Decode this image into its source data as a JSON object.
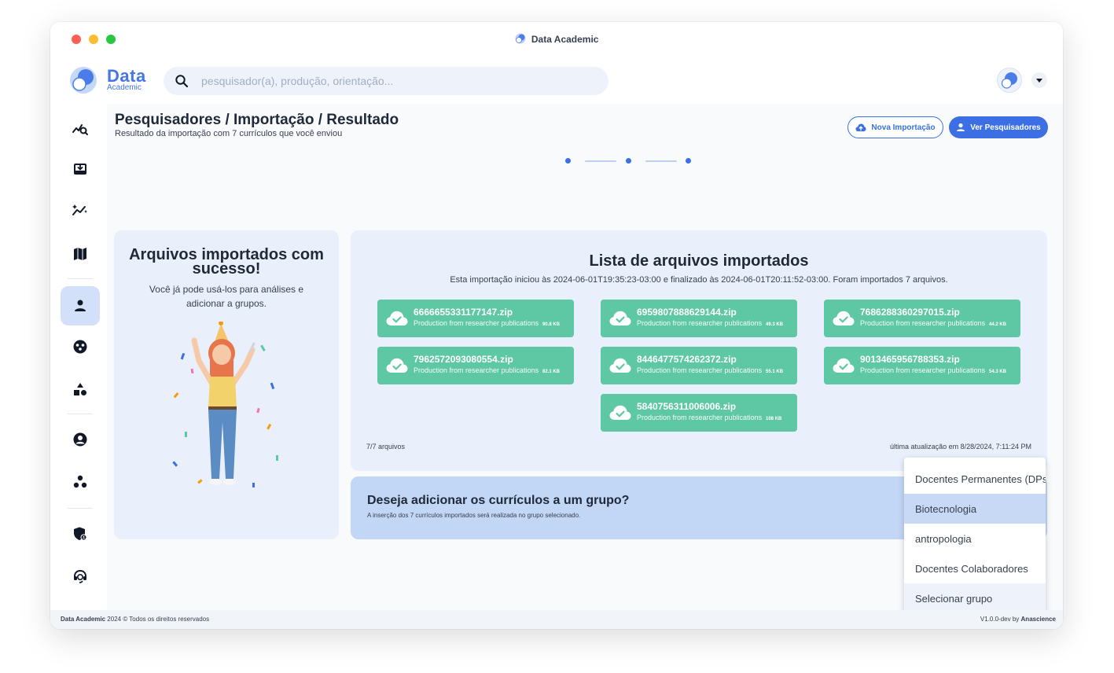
{
  "window": {
    "title": "Data Academic"
  },
  "brand": {
    "name": "Data",
    "tagline": "Academic"
  },
  "search": {
    "placeholder": "pesquisador(a), produção, orientação..."
  },
  "sidebar": {
    "items": [
      {
        "name": "analysis",
        "active": false
      },
      {
        "name": "import",
        "active": false
      },
      {
        "name": "indicators",
        "active": false
      },
      {
        "name": "map",
        "active": false
      },
      {
        "name": "researchers",
        "active": true
      },
      {
        "name": "groups",
        "active": false
      },
      {
        "name": "categories",
        "active": false
      },
      {
        "name": "profile",
        "active": false
      },
      {
        "name": "collaboration",
        "active": false
      },
      {
        "name": "security",
        "active": false
      },
      {
        "name": "support",
        "active": false
      }
    ]
  },
  "header": {
    "title": "Pesquisadores / Importação / Resultado",
    "subtitle": "Resultado da importação com 7 currículos que você enviou",
    "btn_new": "Nova Importação",
    "btn_view": "Ver Pesquisadores"
  },
  "stepper": {
    "steps": 3,
    "current": 3
  },
  "success": {
    "title": "Arquivos importados com sucesso!",
    "text": "Você já pode usá-los para análises e adicionar a grupos."
  },
  "files_list": {
    "title": "Lista de arquivos importados",
    "description": "Esta importação iniciou às 2024-06-01T19:35:23-03:00 e finalizado às 2024-06-01T20:11:52-03:00. Foram importados 7 arquivos.",
    "files": [
      {
        "name": "6666655331177147.zip",
        "desc": "Production from researcher publications",
        "size": "90.8 KB"
      },
      {
        "name": "6959807888629144.zip",
        "desc": "Production from researcher publications",
        "size": "49.3 KB"
      },
      {
        "name": "7686288360297015.zip",
        "desc": "Production from researcher publications",
        "size": "44.2 KB"
      },
      {
        "name": "7962572093080554.zip",
        "desc": "Production from researcher publications",
        "size": "82.1 KB"
      },
      {
        "name": "8446477574262372.zip",
        "desc": "Production from researcher publications",
        "size": "55.1 KB"
      },
      {
        "name": "9013465956788353.zip",
        "desc": "Production from researcher publications",
        "size": "54.3 KB"
      },
      {
        "name": "5840756311006006.zip",
        "desc": "Production from researcher publications",
        "size": "108 KB"
      }
    ],
    "count": "7/7 arquivos",
    "updated": "última atualização em 8/28/2024, 7:11:24 PM"
  },
  "group": {
    "title": "Deseja adicionar os currículos a um grupo?",
    "subtitle": "A inserção dos 7 currículos importados será realizada no grupo selecionado.",
    "options": [
      "Docentes Permanentes (DPs)",
      "Biotecnologia",
      "antropologia",
      "Docentes Colaboradores",
      "Selecionar grupo"
    ],
    "highlighted": "Biotecnologia"
  },
  "footer": {
    "brand": "Data Academic",
    "copyright": "2024 © Todos os direitos reservados",
    "version": "V1.0.0-dev by",
    "vendor": "Anascience"
  },
  "colors": {
    "primary": "#3b6fe3",
    "success": "#5ec7a4",
    "panel": "#e9f0fb",
    "highlight": "#c2d6f5"
  }
}
